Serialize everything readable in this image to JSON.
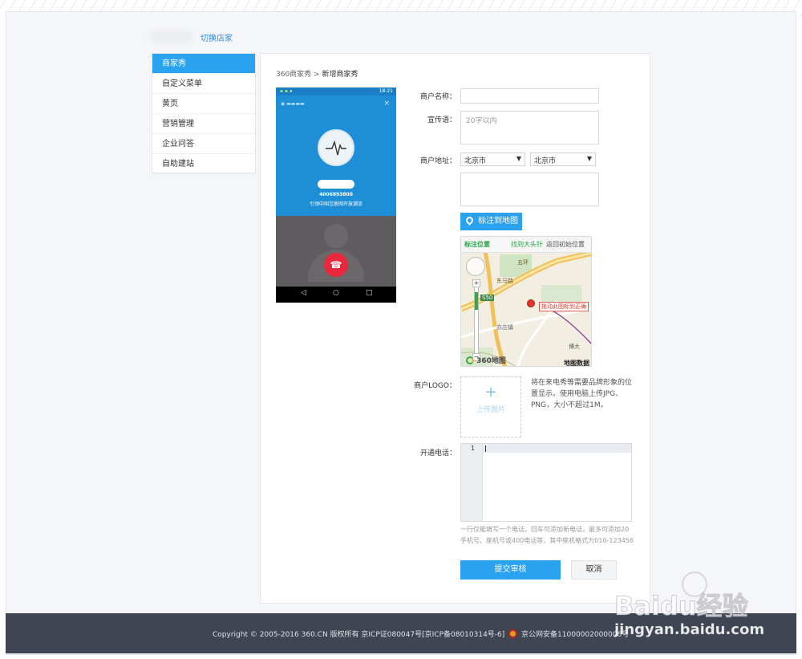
{
  "header": {
    "switch_shop": "切换店家"
  },
  "sidebar": {
    "items": [
      {
        "label": "商家秀",
        "active": true
      },
      {
        "label": "自定义菜单"
      },
      {
        "label": "黄页"
      },
      {
        "label": "营销管理"
      },
      {
        "label": "企业问答"
      },
      {
        "label": "自助建站"
      }
    ]
  },
  "breadcrumb": {
    "root": "360商家秀",
    "sep": " > ",
    "current": "新增商家秀"
  },
  "phone": {
    "time": "18:21",
    "number": "4006893800",
    "slogan": "引领中国互联网开放潮流"
  },
  "form": {
    "name_label": "商户名称：",
    "slogan_label": "宣传语：",
    "slogan_placeholder": "20字以内",
    "address_label": "商户地址：",
    "province": "北京市",
    "city": "北京市",
    "map_button": "标注到地图",
    "logo_label": "商户LOGO：",
    "upload_label": "上传图片",
    "logo_hint": "将在来电秀等需要品牌形象的位置显示。使用电脑上传JPG、PNG，大小不超过1M。",
    "phone_label": "开通电话：",
    "editor_line": "1",
    "phone_hint_1": "一行仅能填写一个电话，回车可添加新电话，最多可添加20",
    "phone_hint_2": "手机号、座机号或400电话等，其中座机格式为010-123456",
    "submit": "提交审核",
    "cancel": "取消"
  },
  "map": {
    "tab_mark": "标注位置",
    "tab_find": "找到大头针",
    "tab_reset": "返回初始位置",
    "callout": "拖动此图标到正确",
    "ring_road": "五环",
    "east_label": "东马路",
    "route": "S50",
    "district": "亦庄镇",
    "poi": "博大",
    "brand": "360地图",
    "data_label": "地图数据"
  },
  "footer": {
    "copyright": "Copyright © 2005-2016 360.CN 版权所有 京ICP证080047号[京ICP备08010314号-6]",
    "police": "京公网安备11000002000006号"
  },
  "watermark": {
    "logo": "Baidu经验",
    "url": "jingyan.baidu.com"
  },
  "colors": {
    "accent": "#2aa2f0",
    "footer_bg": "#3f4552",
    "link": "#2b8be0"
  }
}
